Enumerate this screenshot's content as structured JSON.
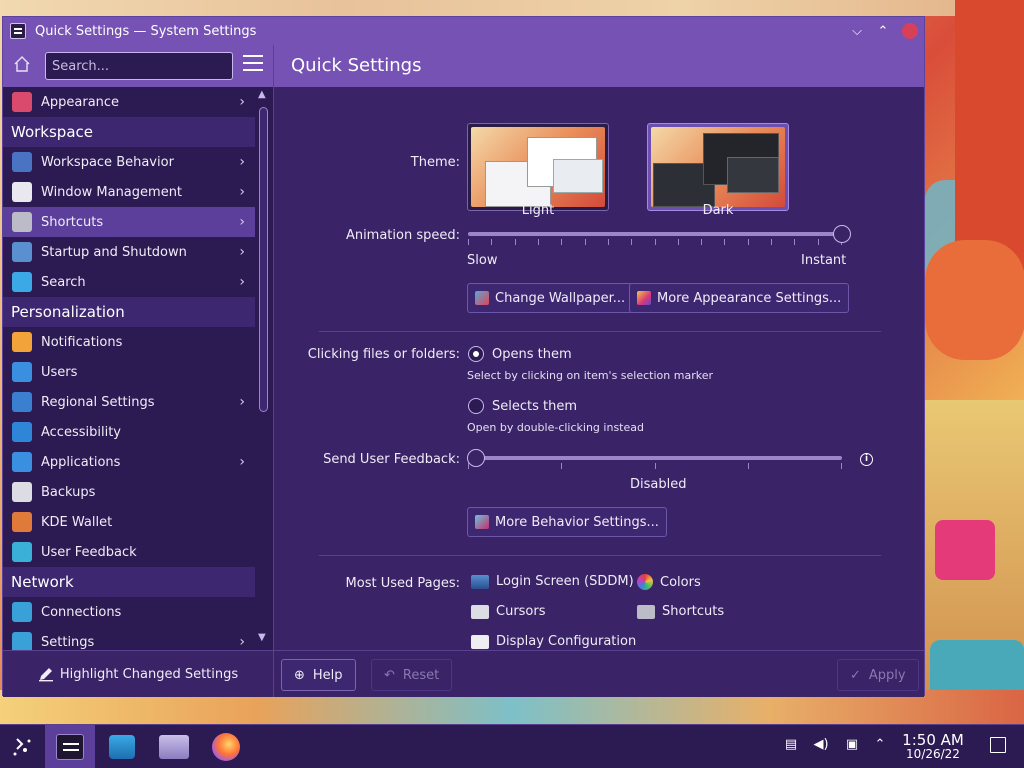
{
  "window": {
    "title": "Quick Settings — System Settings",
    "minimize_glyph": "⌵",
    "maximize_glyph": "⌃"
  },
  "header": {
    "search_placeholder": "Search...",
    "page_title": "Quick Settings"
  },
  "sidebar": {
    "items": [
      {
        "type": "item",
        "label": "Appearance",
        "icon": "appearance-icon",
        "color": "#d94a6c",
        "chevron": true
      },
      {
        "type": "category",
        "label": "Workspace"
      },
      {
        "type": "item",
        "label": "Workspace Behavior",
        "icon": "workspace-behavior-icon",
        "color": "#4b73c4",
        "chevron": true
      },
      {
        "type": "item",
        "label": "Window Management",
        "icon": "window-management-icon",
        "color": "#e8e8ee",
        "chevron": true
      },
      {
        "type": "item",
        "label": "Shortcuts",
        "icon": "keyboard-icon",
        "color": "#bcbcc8",
        "chevron": true,
        "active": true
      },
      {
        "type": "item",
        "label": "Startup and Shutdown",
        "icon": "monitor-icon",
        "color": "#5a8fd0",
        "chevron": true
      },
      {
        "type": "item",
        "label": "Search",
        "icon": "search-icon",
        "color": "#3aa9e6",
        "chevron": true
      },
      {
        "type": "category",
        "label": "Personalization"
      },
      {
        "type": "item",
        "label": "Notifications",
        "icon": "bell-icon",
        "color": "#f2a33a",
        "chevron": false
      },
      {
        "type": "item",
        "label": "Users",
        "icon": "users-icon",
        "color": "#3a8fe0",
        "chevron": false
      },
      {
        "type": "item",
        "label": "Regional Settings",
        "icon": "regional-icon",
        "color": "#3a7fd0",
        "chevron": true
      },
      {
        "type": "item",
        "label": "Accessibility",
        "icon": "accessibility-icon",
        "color": "#2f86d8",
        "chevron": false
      },
      {
        "type": "item",
        "label": "Applications",
        "icon": "applications-icon",
        "color": "#3a8fe0",
        "chevron": true
      },
      {
        "type": "item",
        "label": "Backups",
        "icon": "clock-icon",
        "color": "#dcdce4",
        "chevron": false
      },
      {
        "type": "item",
        "label": "KDE Wallet",
        "icon": "wallet-icon",
        "color": "#e07a3a",
        "chevron": false
      },
      {
        "type": "item",
        "label": "User Feedback",
        "icon": "feedback-icon",
        "color": "#3ab0d8",
        "chevron": false
      },
      {
        "type": "category",
        "label": "Network"
      },
      {
        "type": "item",
        "label": "Connections",
        "icon": "globe-icon",
        "color": "#3aa0d8",
        "chevron": false
      },
      {
        "type": "item",
        "label": "Settings",
        "icon": "network-settings-icon",
        "color": "#3aa0d8",
        "chevron": true
      }
    ],
    "highlight_label": "Highlight Changed Settings"
  },
  "main": {
    "theme_label": "Theme:",
    "theme_light": "Light",
    "theme_dark": "Dark",
    "animation_label": "Animation speed:",
    "animation_min": "Slow",
    "animation_max": "Instant",
    "animation_value": 1.0,
    "change_wallpaper": "Change Wallpaper...",
    "more_appearance": "More Appearance Settings...",
    "clicking_label": "Clicking files or folders:",
    "opens_them": "Opens them",
    "opens_hint": "Select by clicking on item's selection marker",
    "selects_them": "Selects them",
    "selects_hint": "Open by double-clicking instead",
    "feedback_label": "Send User Feedback:",
    "feedback_value_text": "Disabled",
    "feedback_value": 0.0,
    "more_behavior": "More Behavior Settings...",
    "most_used_label": "Most Used Pages:",
    "most_used": {
      "login": "Login Screen (SDDM)",
      "colors": "Colors",
      "cursors": "Cursors",
      "shortcuts": "Shortcuts",
      "display": "Display Configuration"
    }
  },
  "bottom": {
    "help": "Help",
    "reset": "Reset",
    "apply": "Apply"
  },
  "taskbar": {
    "time": "1:50 AM",
    "date": "10/26/22"
  }
}
